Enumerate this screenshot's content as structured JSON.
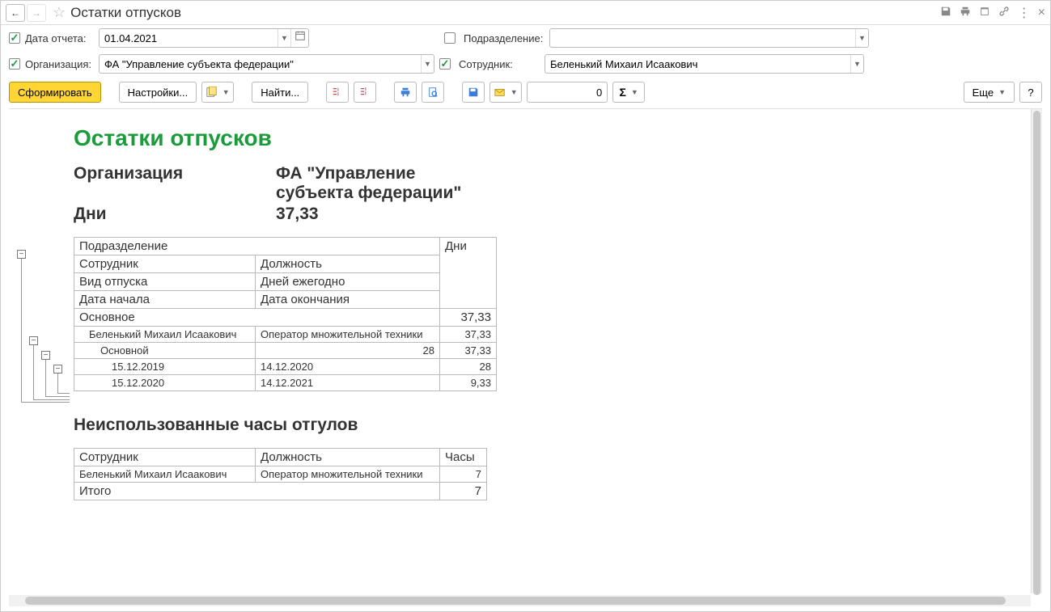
{
  "title": "Остатки отпусков",
  "filters": {
    "date_label": "Дата отчета:",
    "date_value": "01.04.2021",
    "org_label": "Организация:",
    "org_value": "ФА \"Управление субъекта федерации\"",
    "dept_label": "Подразделение:",
    "dept_value": "",
    "emp_label": "Сотрудник:",
    "emp_value": "Беленький Михаил Исаакович"
  },
  "toolbar": {
    "generate": "Сформировать",
    "settings": "Настройки...",
    "find": "Найти...",
    "sum_value": "0",
    "more": "Еще",
    "help": "?"
  },
  "report": {
    "title": "Остатки отпусков",
    "summary": {
      "org_label": "Организация",
      "org_value": "ФА \"Управление субъекта федерации\"",
      "days_label": "Дни",
      "days_value": "37,33"
    },
    "headers": {
      "dept": "Подразделение",
      "days": "Дни",
      "emp": "Сотрудник",
      "pos": "Должность",
      "type": "Вид отпуска",
      "per_year": "Дней ежегодно",
      "start": "Дата начала",
      "end": "Дата окончания"
    },
    "rows": {
      "dept_name": "Основное",
      "dept_days": "37,33",
      "emp_name": "Беленький Михаил Исаакович",
      "emp_pos": "Оператор множительной техники",
      "emp_days": "37,33",
      "type_name": "Основной",
      "type_per_year": "28",
      "type_days": "37,33",
      "p1_start": "15.12.2019",
      "p1_end": "14.12.2020",
      "p1_days": "28",
      "p2_start": "15.12.2020",
      "p2_end": "14.12.2021",
      "p2_days": "9,33"
    },
    "sub_title": "Неиспользованные часы отгулов",
    "sub_headers": {
      "emp": "Сотрудник",
      "pos": "Должность",
      "hours": "Часы"
    },
    "sub_rows": {
      "emp": "Беленький Михаил Исаакович",
      "pos": "Оператор множительной техники",
      "hours": "7",
      "total_label": "Итого",
      "total_hours": "7"
    }
  }
}
